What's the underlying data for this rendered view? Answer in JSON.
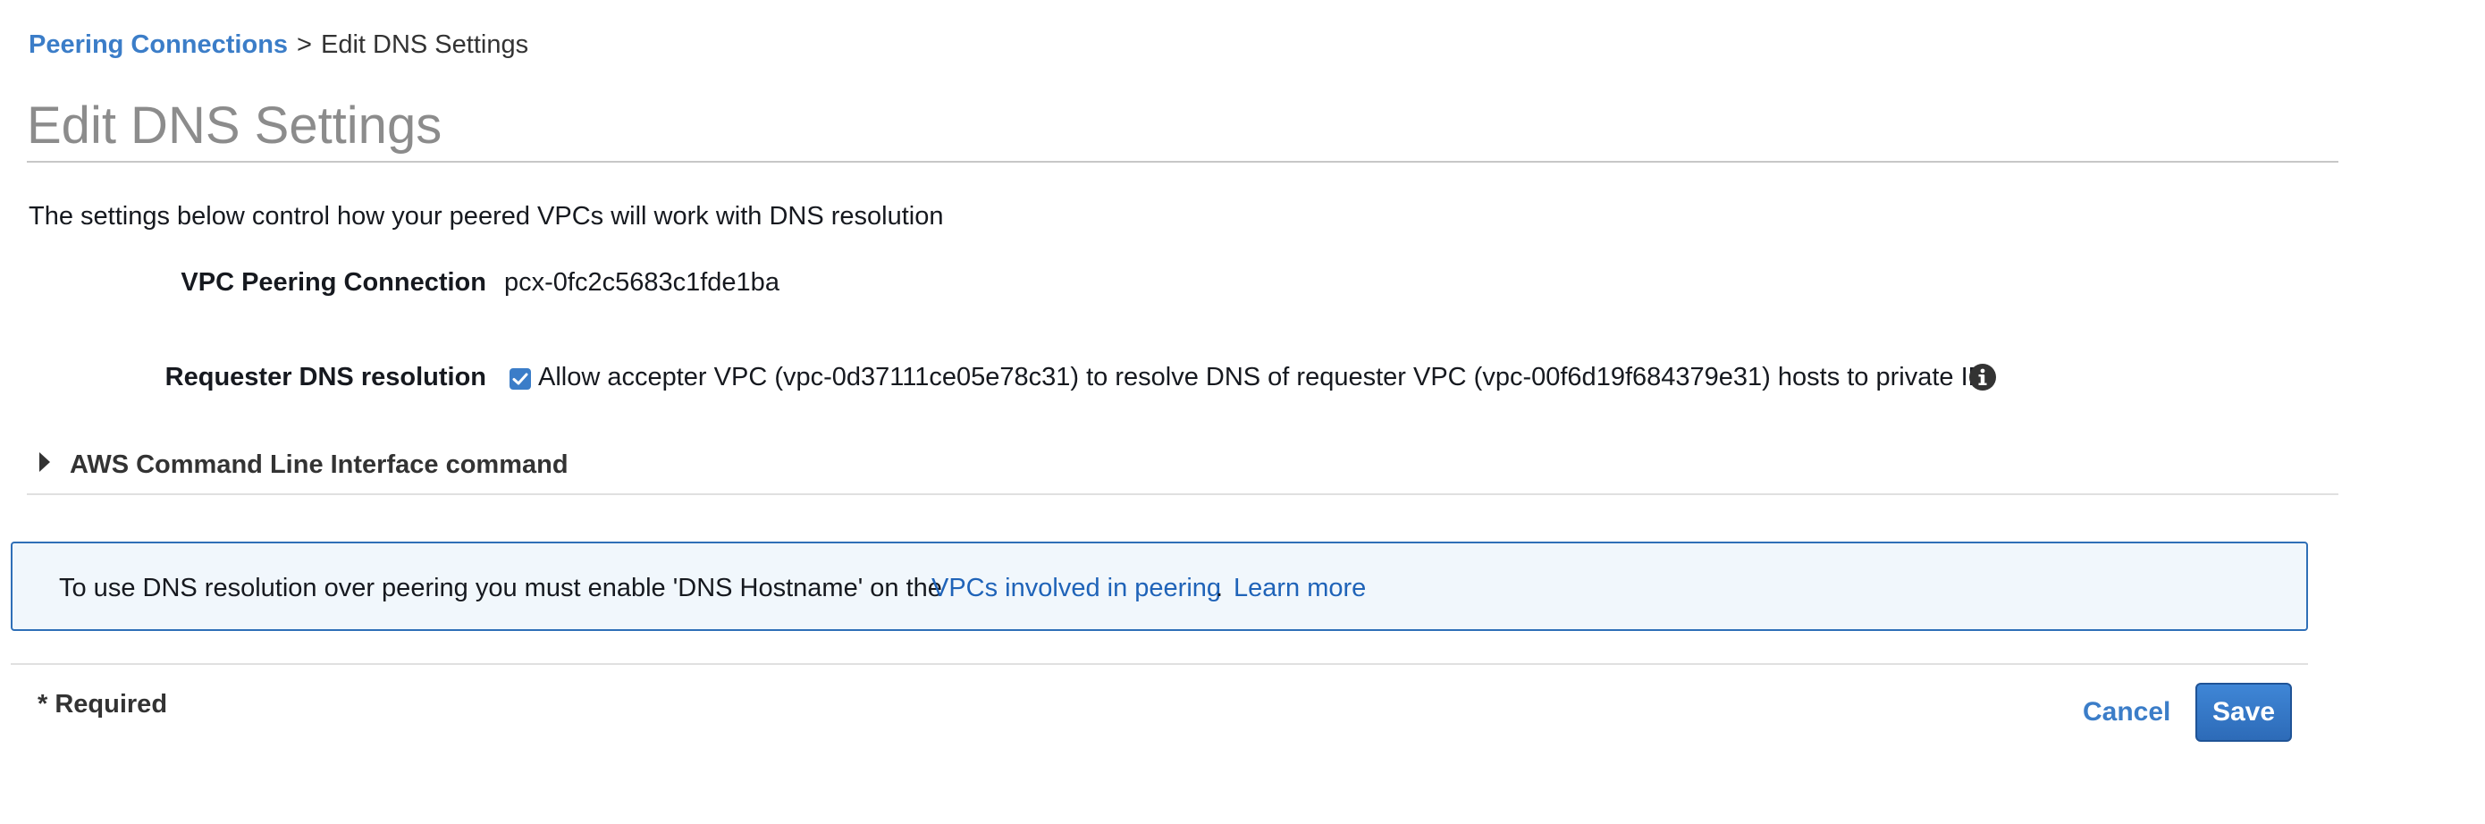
{
  "breadcrumb": {
    "parent": "Peering Connections",
    "separator": ">",
    "current": "Edit DNS Settings"
  },
  "page_title": "Edit DNS Settings",
  "description": "The settings below control how your peered VPCs will work with DNS resolution",
  "fields": {
    "peering_connection": {
      "label": "VPC Peering Connection",
      "value": "pcx-0fc2c5683c1fde1ba"
    },
    "requester_dns": {
      "label": "Requester DNS resolution",
      "checked": true,
      "checkbox_label": "Allow accepter VPC (vpc-0d37111ce05e78c31) to resolve DNS of requester VPC (vpc-00f6d19f684379e31) hosts to private IP",
      "info_icon": "info-icon"
    }
  },
  "cli_expander": {
    "label": "AWS Command Line Interface command",
    "expanded": false
  },
  "info_box": {
    "message": "To use DNS resolution over peering you must enable 'DNS Hostname' on the",
    "link_vpcs": "VPCs involved in peering",
    "period": ".",
    "link_learn_more": "Learn more"
  },
  "footer": {
    "required_note": "* Required",
    "cancel_label": "Cancel",
    "save_label": "Save"
  },
  "colors": {
    "link": "#3b7dc8",
    "primary_button": "#2d6bb8",
    "info_box_bg": "#f1f7fc",
    "info_box_border": "#2f6fb7",
    "title_gray": "#8c8c8c"
  }
}
